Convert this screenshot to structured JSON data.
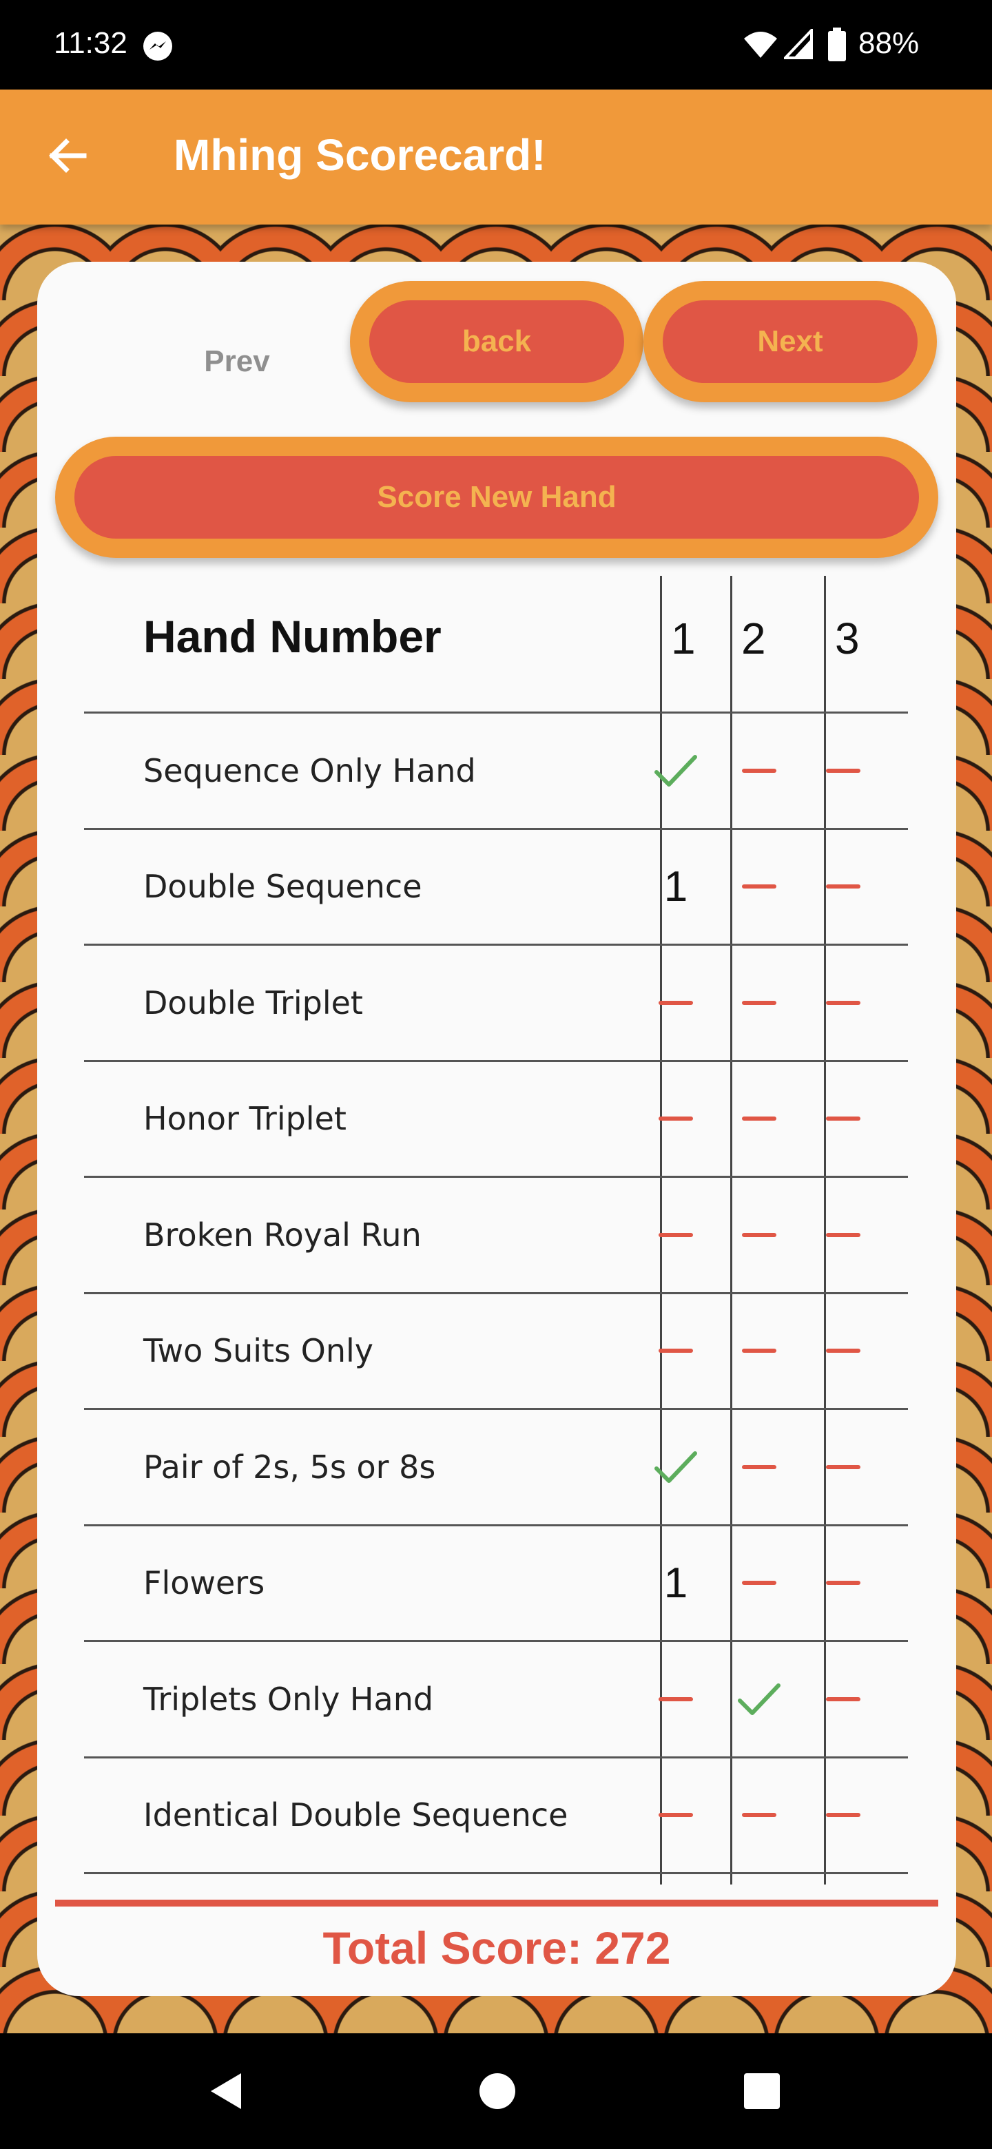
{
  "status_bar": {
    "time": "11:32",
    "battery": "88%",
    "icons": [
      "messenger-icon",
      "wifi-icon",
      "signal-icon",
      "battery-icon"
    ]
  },
  "app_bar": {
    "title": "Mhing Scorecard!",
    "back_icon": "arrow-left-icon"
  },
  "controls": {
    "prev_label": "Prev",
    "back_label": "back",
    "next_label": "Next",
    "score_new_hand_label": "Score New Hand"
  },
  "table": {
    "header_label": "Hand Number",
    "columns": [
      "1",
      "2",
      "3"
    ],
    "rows": [
      {
        "label": "Sequence Only Hand",
        "cells": [
          "check",
          "dash",
          "dash"
        ]
      },
      {
        "label": "Double Sequence",
        "cells": [
          "1",
          "dash",
          "dash"
        ]
      },
      {
        "label": "Double Triplet",
        "cells": [
          "dash",
          "dash",
          "dash"
        ]
      },
      {
        "label": "Honor Triplet",
        "cells": [
          "dash",
          "dash",
          "dash"
        ]
      },
      {
        "label": "Broken Royal Run",
        "cells": [
          "dash",
          "dash",
          "dash"
        ]
      },
      {
        "label": "Two Suits Only",
        "cells": [
          "dash",
          "dash",
          "dash"
        ]
      },
      {
        "label": "Pair of 2s, 5s or 8s",
        "cells": [
          "check",
          "dash",
          "dash"
        ]
      },
      {
        "label": "Flowers",
        "cells": [
          "1",
          "dash",
          "dash"
        ]
      },
      {
        "label": "Triplets Only Hand",
        "cells": [
          "dash",
          "check",
          "dash"
        ]
      },
      {
        "label": "Identical Double Sequence",
        "cells": [
          "dash",
          "dash",
          "dash"
        ]
      }
    ]
  },
  "total": {
    "label": "Total Score: 272"
  },
  "colors": {
    "app_bar": "#f0993a",
    "button_fill": "#e05645",
    "button_text": "#f4b350",
    "check": "#5cad5c",
    "dash": "#e05645"
  },
  "nav_bar": {
    "icons": [
      "nav-back-icon",
      "nav-home-icon",
      "nav-recent-icon"
    ]
  }
}
